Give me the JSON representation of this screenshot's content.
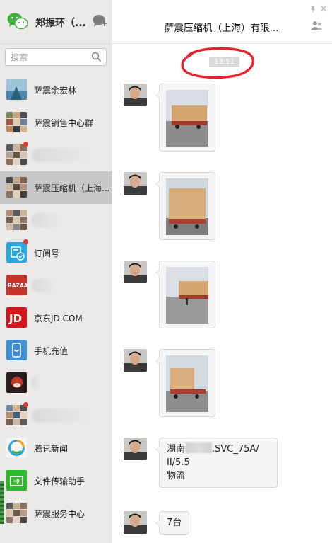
{
  "user": {
    "name": "郑振环（..."
  },
  "search": {
    "placeholder": "搜索"
  },
  "contacts": [
    {
      "name": "萨震余宏林",
      "active": false,
      "badge": false,
      "redacted": false
    },
    {
      "name": "萨震销售中心群",
      "active": false,
      "badge": false,
      "redacted": false
    },
    {
      "name": "",
      "active": false,
      "badge": true,
      "redacted": true
    },
    {
      "name": "萨震压缩机（上海...",
      "active": true,
      "badge": false,
      "redacted": false
    },
    {
      "name": "",
      "active": false,
      "badge": false,
      "redacted": true
    },
    {
      "name": "订阅号",
      "active": false,
      "badge": true,
      "redacted": false
    },
    {
      "name": "",
      "active": false,
      "badge": false,
      "redacted": true
    },
    {
      "name": "京东JD.COM",
      "active": false,
      "badge": false,
      "redacted": false
    },
    {
      "name": "手机充值",
      "active": false,
      "badge": false,
      "redacted": false
    },
    {
      "name": "",
      "active": false,
      "badge": false,
      "redacted": true
    },
    {
      "name": "",
      "active": false,
      "badge": true,
      "redacted": true
    },
    {
      "name": "腾讯新闻",
      "active": false,
      "badge": false,
      "redacted": false
    },
    {
      "name": "文件传输助手",
      "active": false,
      "badge": false,
      "redacted": false
    },
    {
      "name": "萨震服务中心",
      "active": false,
      "badge": false,
      "redacted": false
    }
  ],
  "chat": {
    "title": "萨震压缩机（上海）有限...",
    "time": "13:51",
    "text_message": {
      "prefix": "湖南",
      "line1_suffix": ".SVC_75A/",
      "line2": "II/5.5",
      "line3": "物流"
    },
    "last_message": "7台"
  },
  "colors": {
    "active_row": "#c7c8ca",
    "annotation": "#e8212b",
    "badge": "#e53935",
    "wechat_green": "#3fb33b"
  }
}
